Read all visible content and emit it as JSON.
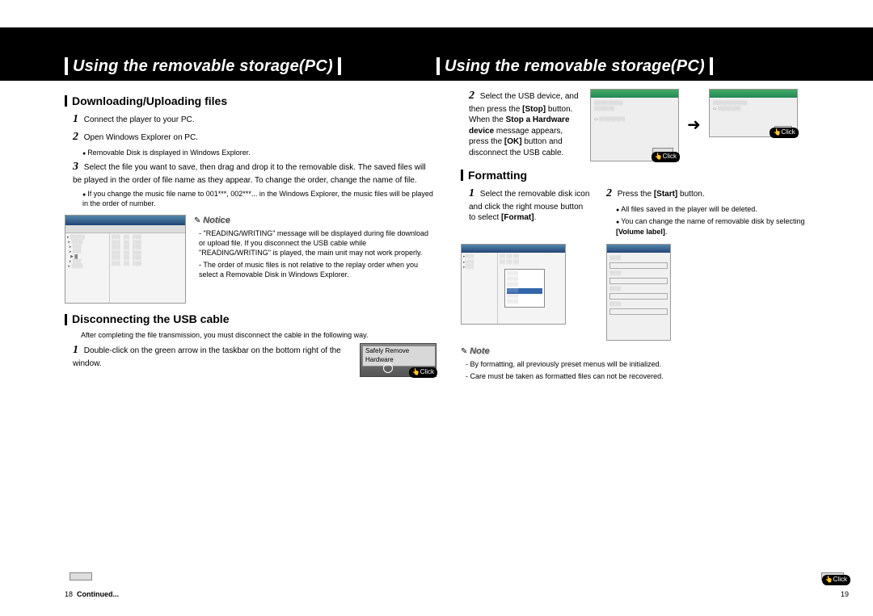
{
  "header_left": "Using the removable storage(PC)",
  "header_right": "Using the removable storage(PC)",
  "left": {
    "section1": {
      "title": "Downloading/Uploading files",
      "step1": "Connect the player to your PC.",
      "step2": "Open Windows Explorer on PC.",
      "step2_bullet": "Removable Disk is displayed in Windows Explorer.",
      "step3": "Select the file you want to save, then drag and drop it to the removable disk. The saved files will be played in the order of file name as they appear. To change the order, change the name of file.",
      "step3_bullet": "If you change the music file name to 001***, 002***... in the Windows Explorer, the music files will be played in the order of number.",
      "notice_label": "Notice",
      "notice1": "\"READING/WRITING\" message will be displayed during file download or upload file. If you disconnect the USB cable while \"READING/WRITING\" is played, the main unit may not work properly.",
      "notice2": "The order of music files is not relative to the replay order when you select a Removable Disk in Windows Explorer."
    },
    "section2": {
      "title": "Disconnecting the USB cable",
      "intro": "After completing the file transmission, you must disconnect the cable in the following way.",
      "step1": "Double-click on the green arrow in the taskbar on the bottom right of the window.",
      "safely_label": "Safely Remove Hardware",
      "click_label": "Click"
    },
    "page_number": "18",
    "continued": "Continued..."
  },
  "right": {
    "step2_top_a": "Select the USB device, and then press the ",
    "step2_top_stop": "[Stop]",
    "step2_top_b": " button. When the ",
    "step2_top_msg": "Stop a Hardware device",
    "step2_top_c": " message appears, press the ",
    "step2_top_ok": "[OK]",
    "step2_top_d": " button and disconnect the USB cable.",
    "click_label": "Click",
    "section3": {
      "title": "Formatting",
      "step1_a": "Select the removable disk icon and click the right mouse button to select ",
      "step1_b": "[Format]",
      "step1_c": ".",
      "step2_a": "Press the ",
      "step2_b": "[Start]",
      "step2_c": " button.",
      "step2_bullet1": "All files saved in the player will be deleted.",
      "step2_bullet2_a": "You can change the name of removable disk by selecting ",
      "step2_bullet2_b": "[Volume label]",
      "step2_bullet2_c": "."
    },
    "note_label": "Note",
    "note1": "By formatting, all previously preset menus will be initialized.",
    "note2": "Care must be taken as formatted files can not be recovered.",
    "page_number": "19"
  }
}
